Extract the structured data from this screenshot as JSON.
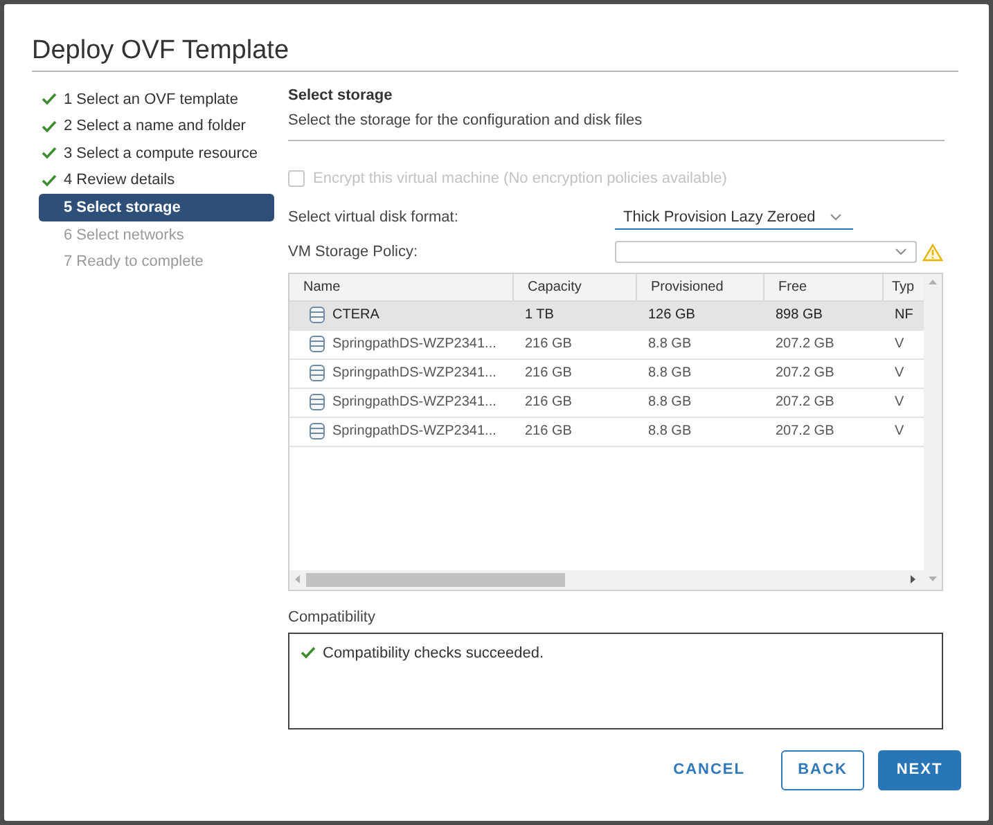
{
  "dialog": {
    "title": "Deploy OVF Template"
  },
  "steps": [
    {
      "label": "1 Select an OVF template",
      "completed": true,
      "selected": false,
      "disabled": false
    },
    {
      "label": "2 Select a name and folder",
      "completed": true,
      "selected": false,
      "disabled": false
    },
    {
      "label": "3 Select a compute resource",
      "completed": true,
      "selected": false,
      "disabled": false
    },
    {
      "label": "4 Review details",
      "completed": true,
      "selected": false,
      "disabled": false
    },
    {
      "label": "5 Select storage",
      "completed": false,
      "selected": true,
      "disabled": false
    },
    {
      "label": "6 Select networks",
      "completed": false,
      "selected": false,
      "disabled": true
    },
    {
      "label": "7 Ready to complete",
      "completed": false,
      "selected": false,
      "disabled": true
    }
  ],
  "page": {
    "heading": "Select storage",
    "subheading": "Select the storage for the configuration and disk files"
  },
  "encrypt": {
    "label": "Encrypt this virtual machine (No encryption policies available)",
    "checked": false,
    "disabled": true
  },
  "disk_format": {
    "label": "Select virtual disk format:",
    "value": "Thick Provision Lazy Zeroed"
  },
  "storage_policy": {
    "label": "VM Storage Policy:",
    "warning": true
  },
  "table": {
    "columns": [
      "Name",
      "Capacity",
      "Provisioned",
      "Free",
      "Typ"
    ],
    "rows": [
      {
        "cells": [
          "CTERA",
          "1 TB",
          "126 GB",
          "898 GB",
          "NF"
        ],
        "selected": true
      },
      {
        "cells": [
          "SpringpathDS-WZP2341...",
          "216 GB",
          "8.8 GB",
          "207.2 GB",
          "V"
        ],
        "selected": false
      },
      {
        "cells": [
          "SpringpathDS-WZP2341...",
          "216 GB",
          "8.8 GB",
          "207.2 GB",
          "V"
        ],
        "selected": false
      },
      {
        "cells": [
          "SpringpathDS-WZP2341...",
          "216 GB",
          "8.8 GB",
          "207.2 GB",
          "V"
        ],
        "selected": false
      },
      {
        "cells": [
          "SpringpathDS-WZP2341...",
          "216 GB",
          "8.8 GB",
          "207.2 GB",
          "V"
        ],
        "selected": false
      }
    ]
  },
  "compatibility": {
    "label": "Compatibility",
    "message": "Compatibility checks succeeded.",
    "passed": true
  },
  "buttons": [
    {
      "label": "CANCEL",
      "kind": "link"
    },
    {
      "label": "BACK",
      "kind": "outline"
    },
    {
      "label": "NEXT",
      "kind": "primary"
    }
  ]
}
